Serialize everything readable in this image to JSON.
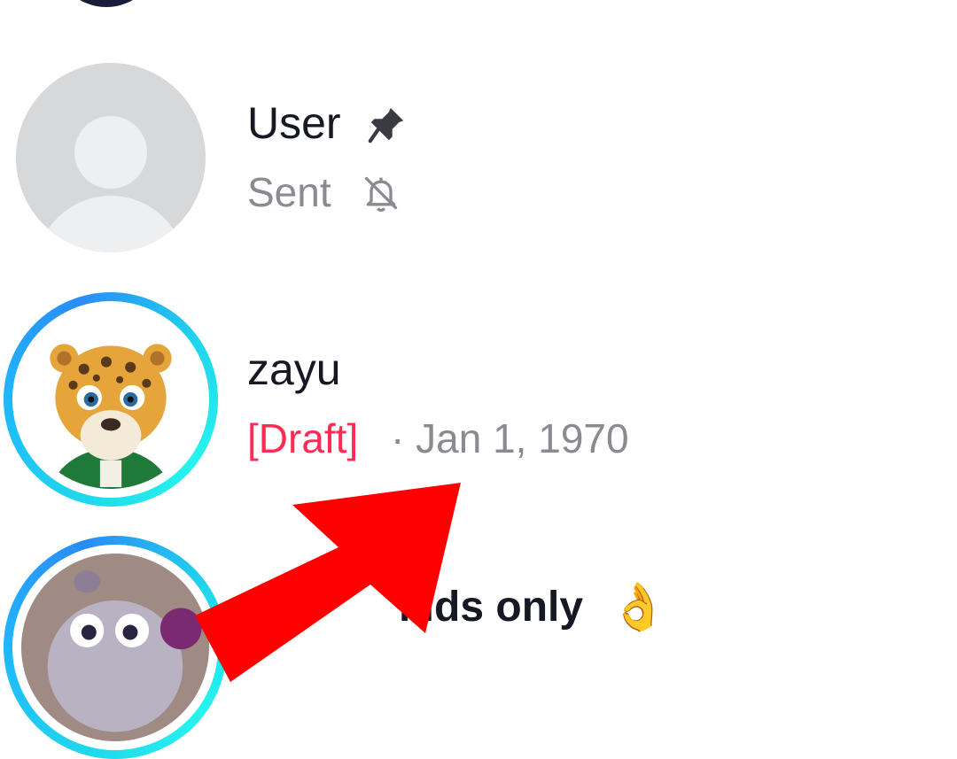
{
  "conversations": [
    {
      "name": "User",
      "status": "Sent",
      "pinned_icon": "pin-icon",
      "muted_icon": "bell-off-icon"
    },
    {
      "name": "zayu",
      "draft_label": "[Draft]",
      "separator": "·",
      "date": "Jan 1, 1970"
    },
    {
      "name": "kids only",
      "emoji": "👌"
    }
  ],
  "colors": {
    "draft": "#fe2c55",
    "ring": "#20d5ec",
    "arrow": "#ff0000"
  }
}
